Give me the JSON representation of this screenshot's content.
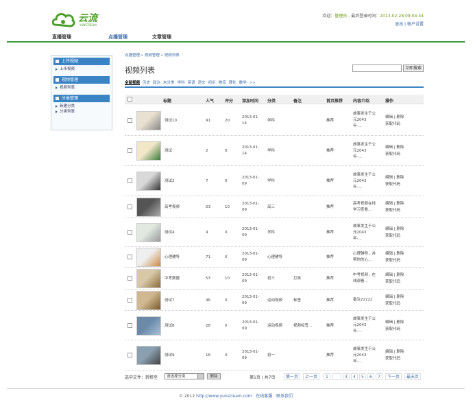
{
  "app": {
    "logo_text": "云流",
    "logo_sub": "YUNSTREAM"
  },
  "top": {
    "welcome": "欢迎：",
    "user": "管理员",
    "sep": " - 最后登录时间：",
    "time": "2013-02-28 09:04:44",
    "logout": "退出",
    "account": "帐户设置"
  },
  "nav": {
    "tabs": [
      "直播管理",
      "点播管理",
      "文章管理"
    ]
  },
  "sidebar": {
    "groups": [
      {
        "title": "上传视频",
        "items": [
          "上传视频"
        ]
      },
      {
        "title": "视频管理",
        "items": [
          "视频列表"
        ]
      },
      {
        "title": "分类管理",
        "items": [
          "新建分类",
          "分类列表"
        ]
      }
    ]
  },
  "breadcrumb": "点播管理 » 视频管理 » 视频列表",
  "page_title": "视频列表",
  "search": {
    "button": "立即搜索"
  },
  "categories": [
    "全部视频",
    "历史",
    "政治",
    "未分类",
    "学科",
    "英语",
    "语文",
    "初步",
    "物流",
    "理化",
    "数学",
    ">>"
  ],
  "table": {
    "headers": [
      "标题",
      "人气",
      "评分",
      "添加时间",
      "分类",
      "备注",
      "首页推荐",
      "内容介绍",
      "操作"
    ],
    "rows": [
      {
        "title": "测试10",
        "pop": "91",
        "score": "20",
        "date": [
          "2013-01-",
          "14"
        ],
        "cat": "学科",
        "note": "",
        "rec": "推荐",
        "intro": [
          "故事发生于公",
          "元2043",
          "年-..."
        ]
      },
      {
        "title": "测试",
        "pop": "2",
        "score": "0",
        "date": [
          "2013-01-",
          "14"
        ],
        "cat": "学科",
        "note": "",
        "rec": "推荐",
        "intro": [
          "故事发生于公",
          "元2043",
          "年-..."
        ]
      },
      {
        "title": "测试2",
        "pop": "7",
        "score": "0",
        "date": [
          "2013-01-",
          "09"
        ],
        "cat": "学科",
        "note": "",
        "rec": "推荐",
        "intro": [
          "故事发生于公",
          "元2043",
          "年-..."
        ]
      },
      {
        "title": "高考视频",
        "pop": "23",
        "score": "10",
        "date": [
          "2013-01-",
          "09"
        ],
        "cat": "高三",
        "note": "",
        "rec": "推荐",
        "intro": [
          "高考视频在线",
          "学习查看..."
        ]
      },
      {
        "title": "测试4",
        "pop": "4",
        "score": "0",
        "date": [
          "2013-01-",
          "09"
        ],
        "cat": "学科",
        "note": "",
        "rec": "推荐",
        "intro": [
          "故事发生于公",
          "元2043",
          "年-..."
        ]
      },
      {
        "title": "心理辅导",
        "pop": "71",
        "score": "0",
        "date": [
          "2013-01-",
          "09"
        ],
        "cat": "心理辅导",
        "note": "",
        "rec": "推荐",
        "intro": [
          "心理辅导，并",
          "帮你的心..."
        ]
      },
      {
        "title": "中考数据",
        "pop": "53",
        "score": "10",
        "date": [
          "2013-01-",
          "09"
        ],
        "cat": "初三",
        "note": "打英",
        "rec": "推荐",
        "intro": [
          "中考视频，在",
          "线观看..."
        ]
      },
      {
        "title": "测试7",
        "pop": "46",
        "score": "0",
        "date": [
          "2013-01-",
          "09"
        ],
        "cat": "运动视频",
        "note": "标签",
        "rec": "推荐",
        "intro": [
          "备注22222"
        ]
      },
      {
        "title": "测试8",
        "pop": "28",
        "score": "0",
        "date": [
          "2013-01-",
          "09"
        ],
        "cat": "运动视频",
        "note": "视频标签...",
        "rec": "推荐",
        "intro": [
          "故事发生于公",
          "元2043",
          "年-..."
        ]
      },
      {
        "title": "测试9",
        "pop": "16",
        "score": "0",
        "date": [
          "2013-01-",
          "09"
        ],
        "cat": "初一",
        "note": "",
        "rec": "推荐",
        "intro": [
          "故事发生于公",
          "元2043",
          "年-..."
        ]
      }
    ],
    "ops": {
      "edit": "编辑",
      "del": "删除",
      "code": "获取代码"
    }
  },
  "pager": {
    "select_label": "选中文件：转移至",
    "select_value": "请选择分类",
    "delete": "删除",
    "info": "第1页 / 共7页",
    "first": "第一页",
    "prev": "上一页",
    "pages": [
      "1",
      "",
      "3",
      "4",
      "5",
      "6",
      "7"
    ],
    "next": "下一页",
    "last": "最末页"
  },
  "footer": {
    "copy": "© 2012",
    "url": "http://www.yunstream.com",
    "link1": "在线客服",
    "link2": "联系我们"
  },
  "colors": {
    "accent": "#3a84c6",
    "brand": "#3a9a3a",
    "link": "#3a6aa8"
  }
}
